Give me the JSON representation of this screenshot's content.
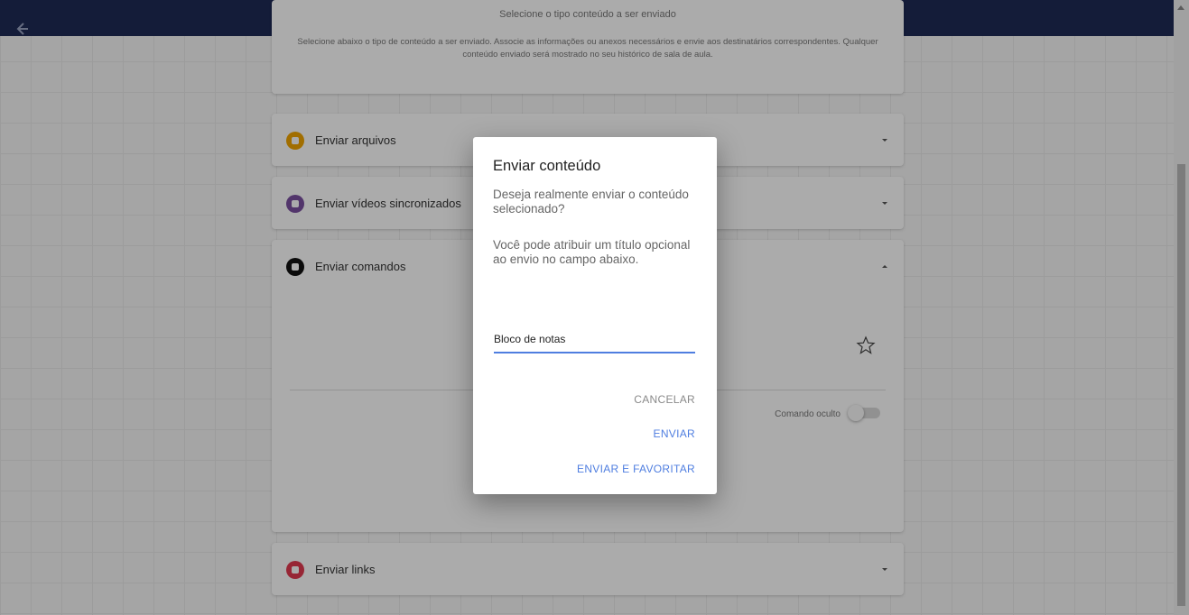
{
  "intro": {
    "title": "Selecione o tipo conteúdo a ser enviado",
    "description": "Selecione abaixo o tipo de conteúdo a ser enviado. Associe as informações ou anexos necessários e envie aos destinatários correspondentes. Qualquer conteúdo enviado será mostrado no seu histórico de sala de aula."
  },
  "panels": [
    {
      "label": "Enviar arquivos",
      "icon": "file-icon",
      "color": "#f0a500",
      "expanded": false
    },
    {
      "label": "Enviar vídeos sincronizados",
      "icon": "video-icon",
      "color": "#7b4fa0",
      "expanded": false
    },
    {
      "label": "Enviar comandos",
      "icon": "terminal-icon",
      "color": "#111111",
      "expanded": true
    },
    {
      "label": "Enviar links",
      "icon": "link-icon",
      "color": "#e23a4f",
      "expanded": false
    }
  ],
  "commands": {
    "hidden_label": "Comando oculto",
    "hidden_enabled": false,
    "favorite_icon": "star-outline-icon"
  },
  "dialog": {
    "title": "Enviar conteúdo",
    "question": "Deseja realmente enviar o conteúdo selecionado?",
    "hint": "Você pode atribuir um título opcional ao envio no campo abaixo.",
    "input_value": "Bloco de notas",
    "cancel": "CANCELAR",
    "send": "ENVIAR",
    "send_favorite": "ENVIAR E FAVORITAR"
  },
  "colors": {
    "header": "#1e2a56",
    "accent": "#4f7ee0"
  }
}
